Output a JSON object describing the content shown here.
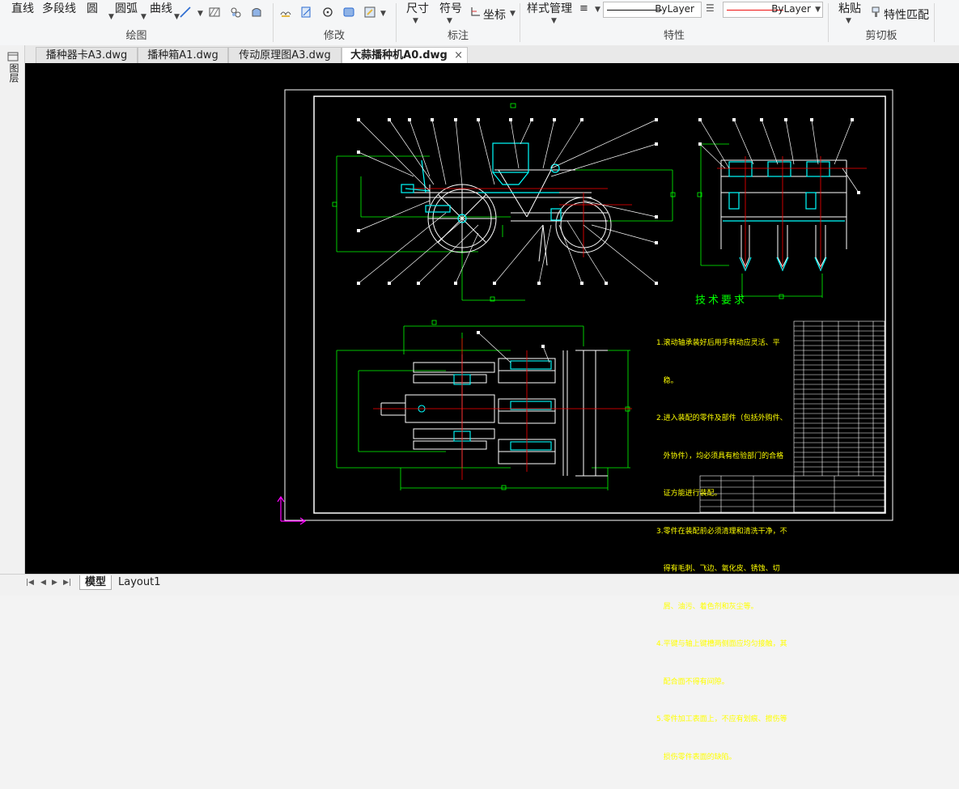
{
  "ribbon": {
    "draw": {
      "title": "绘图",
      "line": "直线",
      "polyline": "多段线",
      "circle": "圆",
      "arc": "圆弧",
      "curve": "曲线"
    },
    "modify": {
      "title": "修改"
    },
    "annotation": {
      "title": "标注",
      "dimension": "尺寸",
      "symbol": "符号",
      "coordinate": "坐标"
    },
    "properties": {
      "title": "特性",
      "style_manager": "样式管理",
      "linetype_value": "ByLayer",
      "color_value": "ByLayer"
    },
    "clipboard": {
      "title": "剪切板",
      "paste": "粘贴",
      "match_properties": "特性匹配"
    }
  },
  "tabs": [
    {
      "label": "播种器卡A3.dwg"
    },
    {
      "label": "播种箱A1.dwg"
    },
    {
      "label": "传动原理图A3.dwg"
    },
    {
      "label": "大蒜播种机A0.dwg",
      "active": true,
      "close": "×"
    }
  ],
  "palette": {
    "label": "图层"
  },
  "drawing": {
    "tech_title": "技术要求",
    "notes": [
      "1.滚动轴承装好后用手转动应灵活、平",
      "   稳。",
      "2.进入装配的零件及部件（包括外购件、",
      "   外协件），均必须具有检验部门的合格",
      "   证方能进行装配。",
      "3.零件在装配前必须清理和清洗干净，不",
      "   得有毛刺、飞边、氧化皮、锈蚀、切",
      "   屑、油污、着色剂和灰尘等。",
      "4.平键与轴上键槽两侧面应均匀接触，其",
      "   配合面不得有间隙。",
      "5.零件加工表面上，不应有划痕、擦伤等",
      "   损伤零件表面的缺陷。"
    ]
  },
  "bottom": {
    "nav": [
      "|◀",
      "◀",
      "▶",
      "▶|"
    ],
    "layouts": [
      {
        "label": "模型",
        "active": true
      },
      {
        "label": "Layout1"
      }
    ]
  },
  "colors": {
    "canvas": "#000000",
    "drawing_white": "#ffffff",
    "green": "#00ff00",
    "cyan": "#00ffff",
    "red": "#ff0000",
    "yellow": "#ffff00",
    "magenta": "#ff00ff"
  }
}
